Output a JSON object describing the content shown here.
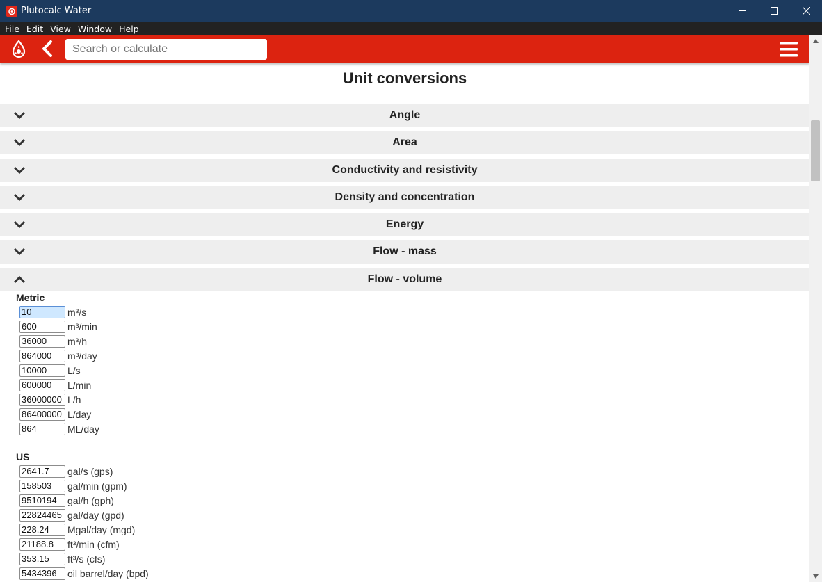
{
  "window": {
    "title": "Plutocalc Water",
    "menu": [
      "File",
      "Edit",
      "View",
      "Window",
      "Help"
    ]
  },
  "appbar": {
    "search_placeholder": "Search or calculate",
    "icons": [
      "logo-icon",
      "back-icon",
      "hamburger-menu-icon"
    ]
  },
  "page": {
    "title": "Unit conversions"
  },
  "sections": [
    {
      "label": "Angle",
      "expanded": false
    },
    {
      "label": "Area",
      "expanded": false
    },
    {
      "label": "Conductivity and resistivity",
      "expanded": false
    },
    {
      "label": "Density and concentration",
      "expanded": false
    },
    {
      "label": "Energy",
      "expanded": false
    },
    {
      "label": "Flow - mass",
      "expanded": false
    },
    {
      "label": "Flow - volume",
      "expanded": true
    }
  ],
  "flow_volume": {
    "metric_title": "Metric",
    "metric": [
      {
        "value": "10",
        "unit": "m³/s"
      },
      {
        "value": "600",
        "unit": "m³/min"
      },
      {
        "value": "36000",
        "unit": "m³/h"
      },
      {
        "value": "864000",
        "unit": "m³/day"
      },
      {
        "value": "10000",
        "unit": "L/s"
      },
      {
        "value": "600000",
        "unit": "L/min"
      },
      {
        "value": "36000000",
        "unit": "L/h"
      },
      {
        "value": "86400000",
        "unit": "L/day"
      },
      {
        "value": "864",
        "unit": "ML/day"
      }
    ],
    "us_title": "US",
    "us": [
      {
        "value": "2641.7",
        "unit": "gal/s (gps)"
      },
      {
        "value": "158503",
        "unit": "gal/min (gpm)"
      },
      {
        "value": "9510194",
        "unit": "gal/h (gph)"
      },
      {
        "value": "22824465",
        "unit": "gal/day (gpd)"
      },
      {
        "value": "228.24",
        "unit": "Mgal/day (mgd)"
      },
      {
        "value": "21188.8",
        "unit": "ft³/min (cfm)"
      },
      {
        "value": "353.15",
        "unit": "ft³/s (cfs)"
      },
      {
        "value": "5434396",
        "unit": "oil barrel/day (bpd)"
      }
    ]
  },
  "colors": {
    "titlebar": "#1c3a5e",
    "menubar": "#222222",
    "appbar": "#dc2310",
    "section_bg": "#eeeeee",
    "active_input": "#cfe8ff"
  }
}
